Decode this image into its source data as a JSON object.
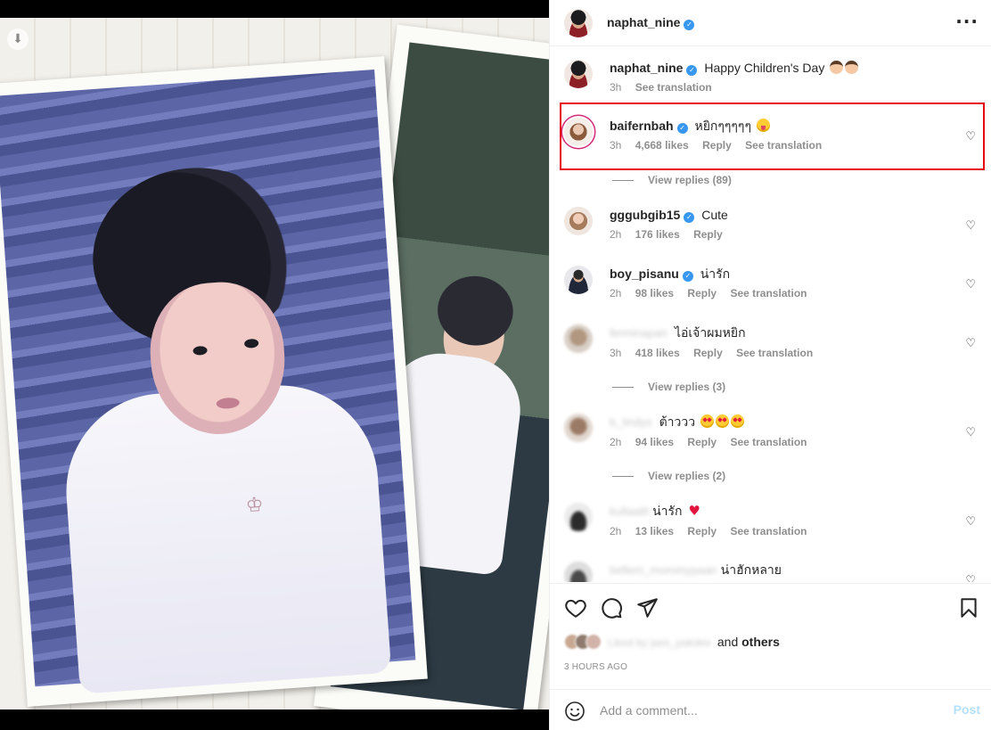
{
  "post": {
    "author": "naphat_nine",
    "caption": "Happy Children's Day",
    "caption_time": "3h",
    "see_translation": "See translation"
  },
  "comments": [
    {
      "user": "baifernbah",
      "text": "หยิกๆๆๆๆๆ",
      "time": "3h",
      "likes": "4,668 likes",
      "reply": "Reply",
      "translate": "See translation",
      "replies": "View replies (89)",
      "highlighted": true
    },
    {
      "user": "gggubgib15",
      "text": "Cute",
      "time": "2h",
      "likes": "176 likes",
      "reply": "Reply"
    },
    {
      "user": "boy_pisanu",
      "text": "น่ารัก",
      "time": "2h",
      "likes": "98 likes",
      "reply": "Reply",
      "translate": "See translation"
    },
    {
      "user_hidden": true,
      "text": "ไอ่เจ้าผมหยิก",
      "time": "3h",
      "likes": "418 likes",
      "reply": "Reply",
      "translate": "See translation",
      "replies": "View replies (3)"
    },
    {
      "user_hidden": true,
      "text": "ต้าววว",
      "time": "2h",
      "likes": "94 likes",
      "reply": "Reply",
      "translate": "See translation",
      "replies": "View replies (2)"
    },
    {
      "user_hidden": true,
      "text": "น่ารัก",
      "time": "2h",
      "likes": "13 likes",
      "reply": "Reply",
      "translate": "See translation"
    },
    {
      "user_hidden": true,
      "text": "น่าฮักหลาย"
    }
  ],
  "likes_summary": {
    "and_text": "and",
    "others": "others"
  },
  "timestamp": "3 HOURS AGO",
  "add_comment": {
    "placeholder": "Add a comment...",
    "post_label": "Post"
  },
  "icons": {
    "more": "more-horizontal-icon",
    "like": "heart-icon",
    "comment": "comment-bubble-icon",
    "share": "paper-plane-icon",
    "save": "bookmark-icon",
    "emoji": "smiley-icon",
    "download": "download-arrow-icon"
  },
  "colors": {
    "verified": "#3897f0",
    "highlight_box": "#e50914",
    "post_button": "#b2dffc"
  }
}
